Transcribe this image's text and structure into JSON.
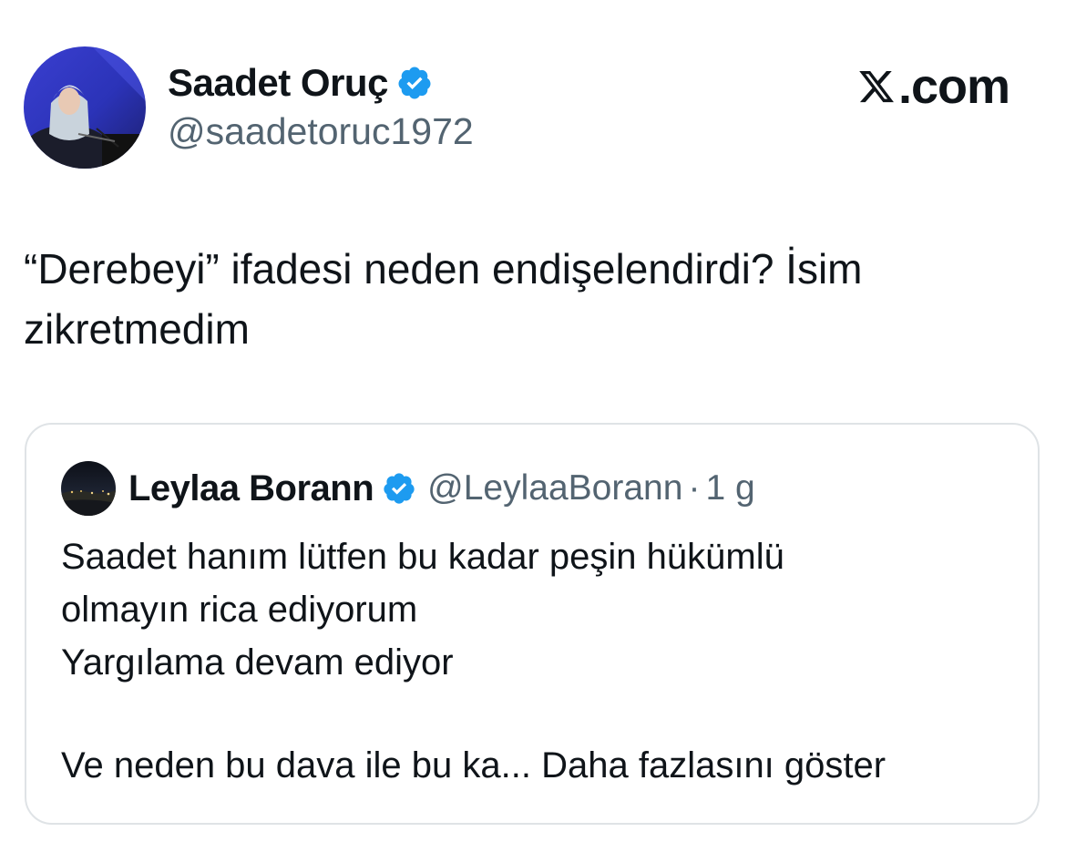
{
  "tweet": {
    "author": {
      "name": "Saadet Oruç",
      "handle": "@saadetoruc1972",
      "verified": true,
      "avatar_icon": "profile-photo"
    },
    "site_label": ".com",
    "site_icon": "x-logo-icon",
    "text": "“Derebeyi” ifadesi neden endişelendirdi? İsim\nzikretmedim"
  },
  "quoted_tweet": {
    "author": {
      "name": "Leylaa Borann",
      "handle": "@LeylaaBorann",
      "verified": true,
      "avatar_icon": "profile-photo"
    },
    "separator": "·",
    "time": "1 g",
    "text": "Saadet hanım lütfen bu kadar peşin hükümlü\nolmayın rica ediyorum\nYargılama devam ediyor",
    "truncated_text": "Ve neden bu dava ile bu ka...",
    "show_more_label": "Daha fazlasını göster"
  },
  "colors": {
    "text_primary": "#0f1419",
    "text_secondary": "#536471",
    "verified_blue": "#1d9bf0",
    "card_border": "#dfe3e6"
  }
}
